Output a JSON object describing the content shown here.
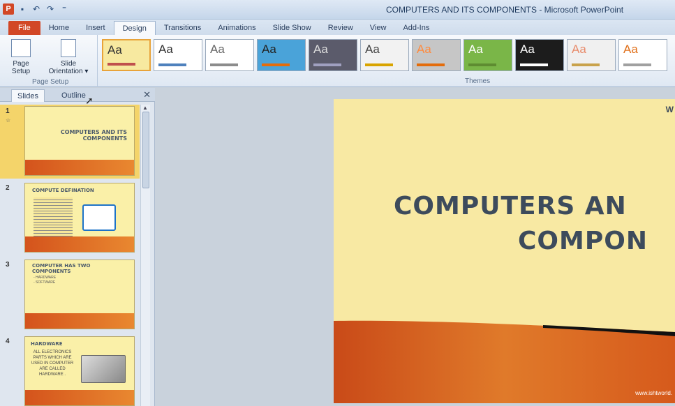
{
  "titlebar": {
    "app_icon": "P",
    "qat": [
      "save-icon",
      "undo-icon",
      "redo-icon",
      "customize-icon"
    ],
    "title": "COMPUTERS AND ITS COMPONENTS - Microsoft PowerPoint"
  },
  "tabs": [
    "File",
    "Home",
    "Insert",
    "Design",
    "Transitions",
    "Animations",
    "Slide Show",
    "Review",
    "View",
    "Add-Ins"
  ],
  "active_tab": "Design",
  "ribbon": {
    "page_setup": {
      "page_setup_label": "Page Setup",
      "page_setup_line1": "Page",
      "page_setup_line2": "Setup",
      "orientation_line1": "Slide",
      "orientation_line2": "Orientation",
      "group_label": "Page Setup"
    },
    "themes": {
      "group_label": "Themes",
      "items": [
        {
          "label": "Aa",
          "bg": "#f7e9a0",
          "fg": "#333333",
          "bar": "#c0504d"
        },
        {
          "label": "Aa",
          "bg": "#ffffff",
          "fg": "#333333",
          "bar": "#4f81bd"
        },
        {
          "label": "Aa",
          "bg": "#ffffff",
          "fg": "#666666",
          "bar": "#8c8c8c"
        },
        {
          "label": "Aa",
          "bg": "#4aa3d9",
          "fg": "#222222",
          "bar": "#e46c0a"
        },
        {
          "label": "Aa",
          "bg": "#5b5b6b",
          "fg": "#dddddd",
          "bar": "#a0a0c0"
        },
        {
          "label": "Aa",
          "bg": "#f2f2f2",
          "fg": "#444444",
          "bar": "#d9a400"
        },
        {
          "label": "Aa",
          "bg": "#c6c6c6",
          "fg": "#ff8a3d",
          "bar": "#e46c0a"
        },
        {
          "label": "Aa",
          "bg": "#7ab648",
          "fg": "#ffffff",
          "bar": "#5e8c31"
        },
        {
          "label": "Aa",
          "bg": "#1c1c1c",
          "fg": "#ffffff",
          "bar": "#ffffff"
        },
        {
          "label": "Aa",
          "bg": "#f0f0f0",
          "fg": "#e88a6a",
          "bar": "#c9a24b"
        },
        {
          "label": "Aa",
          "bg": "#ffffff",
          "fg": "#e0701a",
          "bar": "#a0a0a0"
        }
      ]
    }
  },
  "left_pane": {
    "tabs": [
      "Slides",
      "Outline"
    ],
    "active_tab": "Slides",
    "slides": [
      {
        "number": "1",
        "title": "COMPUTERS AND ITS COMPONENTS"
      },
      {
        "number": "2",
        "title": "COMPUTE DEFINATION"
      },
      {
        "number": "3",
        "title": "COMPUTER HAS TWO COMPONENTS",
        "bullets": [
          "- HARDWARE",
          "- SOFTWARE"
        ]
      },
      {
        "number": "4",
        "title": "HARDWARE",
        "body": "ALL ELECTRONICS PARTS WHICH ARE USED IN COMPUTER ARE CALLED HARDWARE ."
      }
    ]
  },
  "main_slide": {
    "title_line1": "COMPUTERS AN",
    "title_line2": "COMPON",
    "corner_text": "W",
    "footer_url": "www.ishtworld."
  }
}
